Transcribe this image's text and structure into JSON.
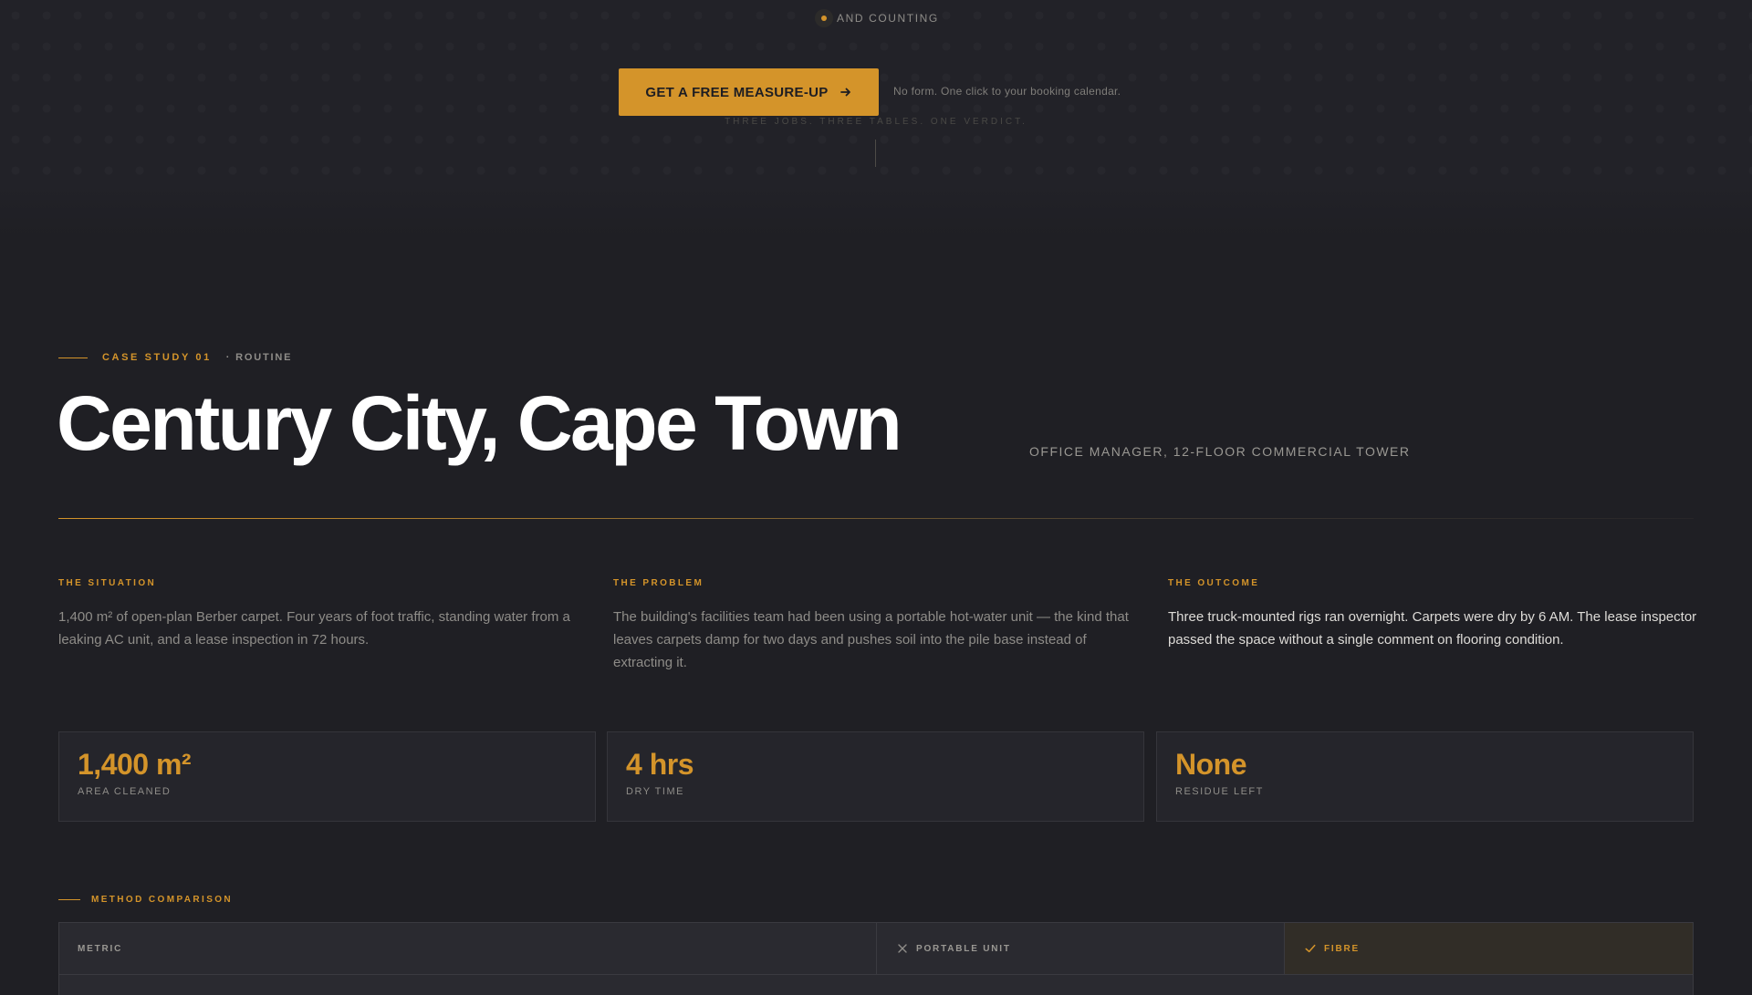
{
  "hero": {
    "badge_text": "AND COUNTING",
    "cta_label": "GET A FREE MEASURE-UP",
    "cta_note": "No form. One click to your booking calendar.",
    "tagline": "THREE JOBS. THREE TABLES. ONE VERDICT."
  },
  "case_study": {
    "eyebrow": "CASE STUDY 01",
    "tag": "· ROUTINE",
    "title": "Century City, Cape Town",
    "role": "OFFICE MANAGER, 12-FLOOR COMMERCIAL TOWER",
    "columns": [
      {
        "label": "THE SITUATION",
        "text": "1,400 m² of open-plan Berber carpet. Four years of foot traffic, standing water from a leaking AC unit, and a lease inspection in 72 hours."
      },
      {
        "label": "THE PROBLEM",
        "text": "The building's facilities team had been using a portable hot-water unit — the kind that leaves carpets damp for two days and pushes soil into the pile base instead of extracting it."
      },
      {
        "label": "THE OUTCOME",
        "text": "Three truck-mounted rigs ran overnight. Carpets were dry by 6 AM. The lease inspector passed the space without a single comment on flooring condition."
      }
    ],
    "stats": [
      {
        "value": "1,400 m²",
        "label": "AREA CLEANED"
      },
      {
        "value": "4 hrs",
        "label": "DRY TIME"
      },
      {
        "value": "None",
        "label": "RESIDUE LEFT"
      }
    ]
  },
  "method_comparison": {
    "eyebrow": "METHOD COMPARISON",
    "headers": {
      "metric": "METRIC",
      "portable": "PORTABLE UNIT",
      "fibre": "FIBRE"
    }
  },
  "colors": {
    "accent": "#d4942a",
    "background": "#1f1f24",
    "card": "#25252b"
  }
}
